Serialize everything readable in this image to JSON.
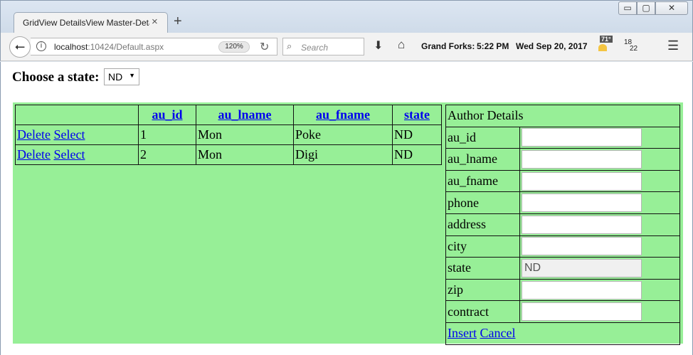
{
  "window": {
    "min": "▭",
    "max": "▢",
    "close": "✕"
  },
  "tab": {
    "title": "GridView DetailsView Master-Deta",
    "close": "×",
    "new": "+"
  },
  "nav": {
    "url_host": "localhost",
    "url_rest": ":10424/Default.aspx",
    "zoom": "120%",
    "search_placeholder": "Search",
    "weather_place": "Grand Forks:",
    "weather_time": "5:22 PM",
    "weather_date": "Wed Sep 20, 2017",
    "temperature": "71°",
    "counter_top": "18",
    "counter_bottom": "22"
  },
  "page": {
    "state_label": "Choose a state:",
    "state_selected": "ND",
    "grid": {
      "headers": [
        "",
        "au_id",
        "au_lname",
        "au_fname",
        "state"
      ],
      "rows": [
        {
          "delete": "Delete",
          "select": "Select",
          "au_id": "1",
          "au_lname": "Mon",
          "au_fname": "Poke",
          "state": "ND"
        },
        {
          "delete": "Delete",
          "select": "Select",
          "au_id": "2",
          "au_lname": "Mon",
          "au_fname": "Digi",
          "state": "ND"
        }
      ]
    },
    "details": {
      "title": "Author Details",
      "fields": [
        "au_id",
        "au_lname",
        "au_fname",
        "phone",
        "address",
        "city",
        "state",
        "zip",
        "contract"
      ],
      "state_value": "ND",
      "insert": "Insert",
      "cancel": "Cancel"
    }
  }
}
